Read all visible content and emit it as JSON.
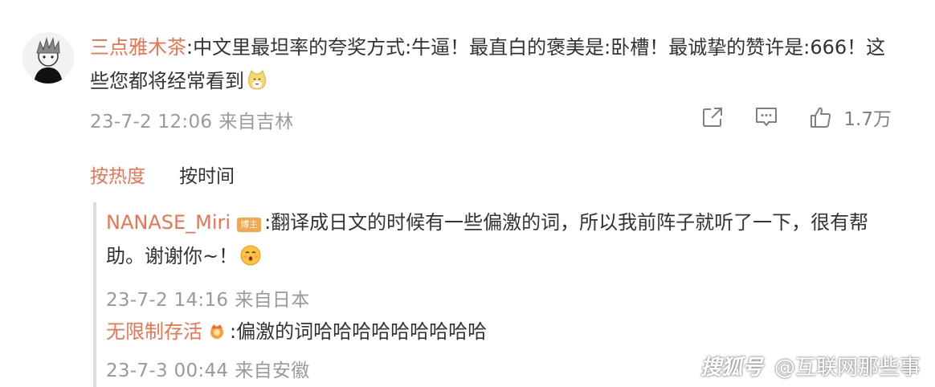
{
  "main_comment": {
    "username": "三点雅木茶",
    "separator": ":",
    "text": "中文里最坦率的夸奖方式:牛逼！最直白的褒美是:卧槽！最诚挚的赞许是:666！这些您都将经常看到",
    "emoji_icon": "cat-face-icon",
    "timestamp": "23-7-2 12:06",
    "location": "来自吉林",
    "like_count": "1.7万"
  },
  "actions": {
    "share_icon": "share-icon",
    "comment_icon": "comment-icon",
    "like_icon": "thumbs-up-icon"
  },
  "sort_tabs": [
    {
      "label": "按热度",
      "active": true
    },
    {
      "label": "按时间",
      "active": false
    }
  ],
  "replies": [
    {
      "username": "NANASE_Miri",
      "badge": "博主",
      "separator": ":",
      "text": "翻译成日文的时候有一些偏激的词，所以我前阵子就听了一下，很有帮助。谢谢你~！",
      "emoji_icon": "kissing-face-icon",
      "timestamp": "23-7-2 14:16",
      "location": "来自日本"
    },
    {
      "username": "无限制存活",
      "badge_icon": "crown-icon",
      "separator": ":",
      "text": "偏激的词哈哈哈哈哈哈哈哈哈",
      "timestamp": "23-7-3 00:44",
      "location": "来自安徽"
    }
  ],
  "watermark": {
    "brand": "搜狐号",
    "handle": "@互联网那些事"
  },
  "colors": {
    "username": "#eb7350",
    "meta": "#9a9a9a",
    "text": "#333333",
    "divider": "#dddddd"
  }
}
